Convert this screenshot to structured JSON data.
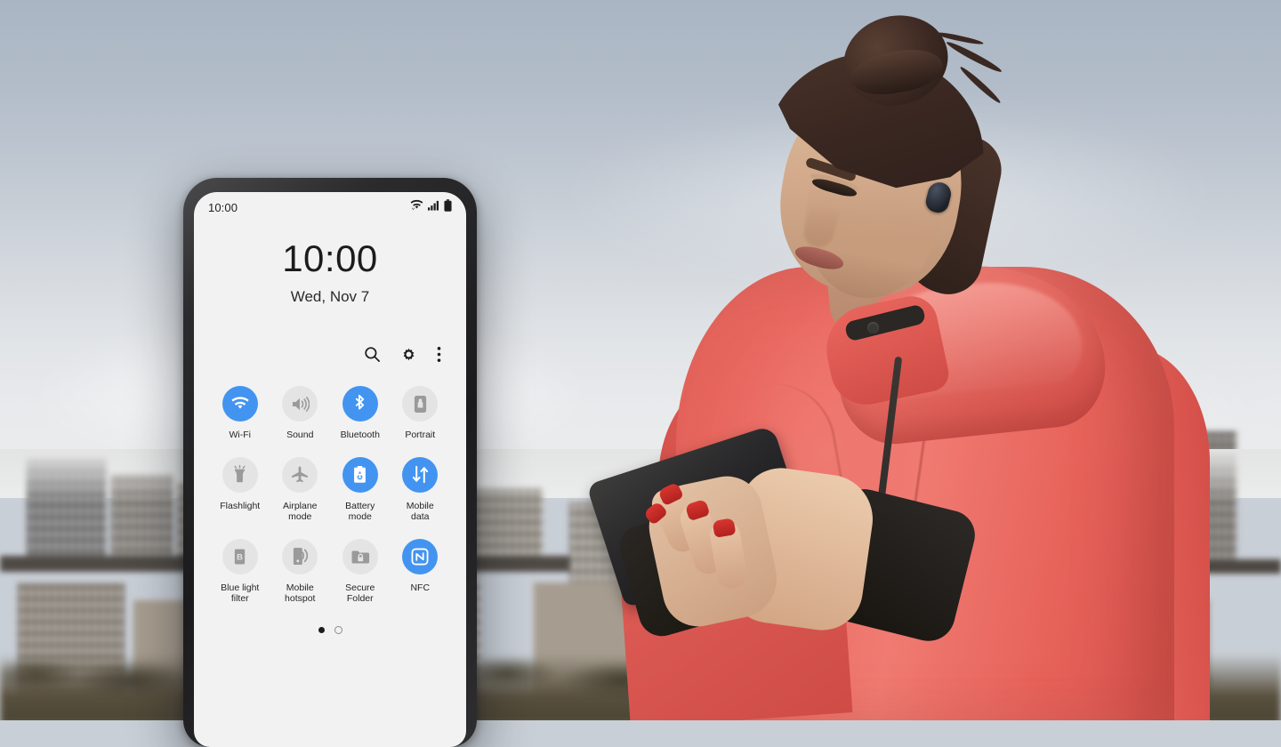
{
  "scene": {
    "description": "Samsung phone quick-settings panel shown over a photo of a woman outdoors using a phone",
    "colors": {
      "accent_blue": "#4294f0",
      "inactive_gray": "#e4e4e4",
      "inactive_icon": "#9a9a9a",
      "screen_background": "#f2f2f2",
      "phone_frame": "#1b1b1d",
      "text_primary": "#1c1c1c",
      "hoodie_coral": "#e8635f"
    }
  },
  "phone": {
    "status_bar": {
      "time": "10:00",
      "icons": [
        {
          "name": "wifi-icon",
          "label": "Wi-Fi signal"
        },
        {
          "name": "cellular-signal-icon",
          "label": "Cellular signal"
        },
        {
          "name": "battery-icon",
          "label": "Battery full"
        }
      ]
    },
    "clock": {
      "time": "10:00",
      "date": "Wed, Nov 7"
    },
    "actions": [
      {
        "name": "search-icon",
        "label": "Search"
      },
      {
        "name": "gear-icon",
        "label": "Settings"
      },
      {
        "name": "more-options-icon",
        "label": "More options"
      }
    ],
    "quick_settings": [
      {
        "label": "Wi-Fi",
        "icon": "wifi-icon",
        "state": "on"
      },
      {
        "label": "Sound",
        "icon": "sound-icon",
        "state": "off"
      },
      {
        "label": "Bluetooth",
        "icon": "bluetooth-icon",
        "state": "on"
      },
      {
        "label": "Portrait",
        "icon": "portrait-rotate-icon",
        "state": "off"
      },
      {
        "label": "Flashlight",
        "icon": "flashlight-icon",
        "state": "off"
      },
      {
        "label": "Airplane\nmode",
        "icon": "airplane-icon",
        "state": "off"
      },
      {
        "label": "Battery\nmode",
        "icon": "battery-mode-icon",
        "state": "on"
      },
      {
        "label": "Mobile\ndata",
        "icon": "mobile-data-icon",
        "state": "on"
      },
      {
        "label": "Blue light\nfilter",
        "icon": "blue-light-filter-icon",
        "state": "off"
      },
      {
        "label": "Mobile\nhotspot",
        "icon": "mobile-hotspot-icon",
        "state": "off"
      },
      {
        "label": "Secure\nFolder",
        "icon": "secure-folder-icon",
        "state": "off"
      },
      {
        "label": "NFC",
        "icon": "nfc-icon",
        "state": "on"
      }
    ],
    "pagination": {
      "total": 2,
      "current": 1
    }
  }
}
